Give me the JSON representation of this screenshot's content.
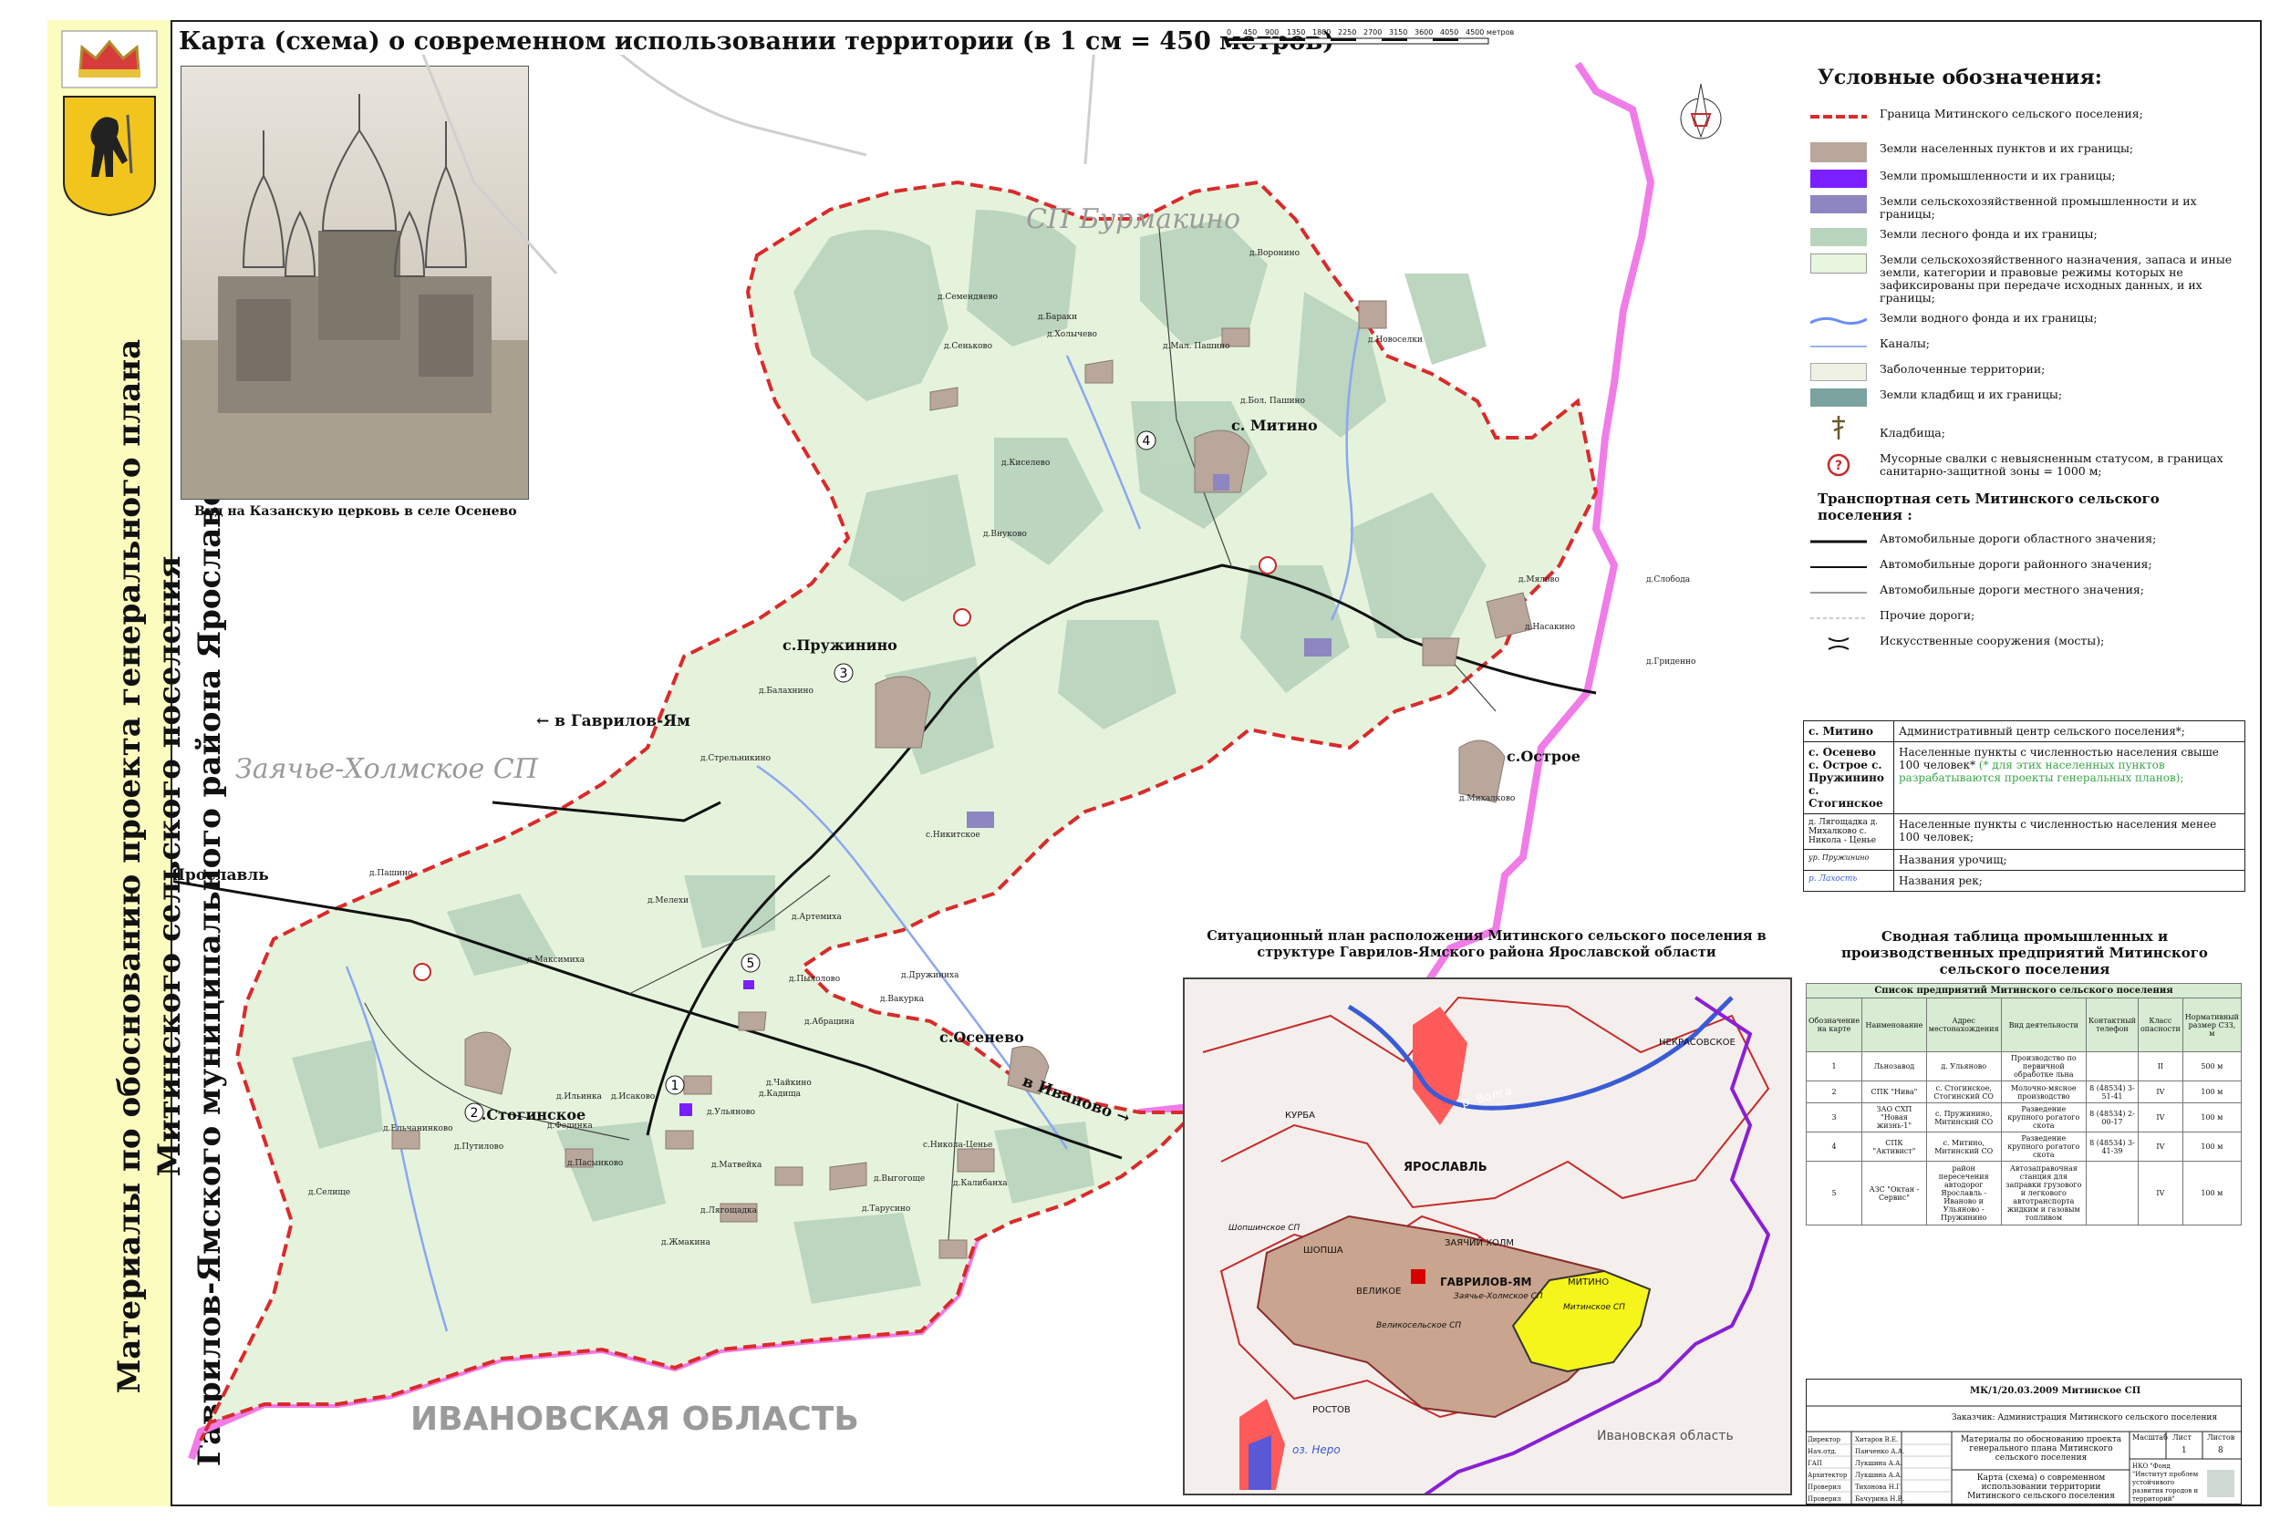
{
  "title_vertical": [
    "Материалы по обоснованию проекта генерального плана",
    "Митинского сельского поселения",
    "Гаврилов-Ямского муниципального района Ярославской области"
  ],
  "header": {
    "title": "Карта (схема) о современном использовании территории (в 1 см = 450 метров)",
    "scale_ticks": [
      "0",
      "450",
      "900",
      "1350",
      "1800",
      "2250",
      "2700",
      "3150",
      "3600",
      "4050",
      "4500 метров"
    ]
  },
  "photo": {
    "caption": "Вид на Казанскую церковь в селе Осенево"
  },
  "map": {
    "neighbors": [
      "СП Бурмакино",
      "Заячье-Холмское СП",
      "ИВАНОВСКАЯ ОБЛАСТЬ"
    ],
    "directions": [
      "← в Гаврилов-Ям",
      "← в Ярославль",
      "в Иваново →"
    ],
    "main_villages": [
      "с. Митино",
      "с.Пружинино",
      "с.Острое",
      "с.Осенево",
      "с.Стогинское"
    ],
    "numbers": [
      "1",
      "2",
      "3",
      "4",
      "5"
    ],
    "villages": [
      "д.Воронино",
      "д.Новоселки",
      "д.Мал. Пашино",
      "д.Бол. Пашино",
      "д.Семендяево",
      "д.Бараки",
      "д.Холычево",
      "д.Сеньково",
      "д.Киселево",
      "д.Внуково",
      "д.Мялово",
      "д.Слобода",
      "д.Насакино",
      "д.Гриденно",
      "д.Михалково",
      "д.Балахнино",
      "д.Стрельникино",
      "с.Никитское",
      "д.Мелехи",
      "д.Артемиха",
      "д.Пашино",
      "д.Максимиха",
      "д.Пылолово",
      "д.Дружиниха",
      "д.Вакурка",
      "д.Абрацина",
      "д.Ильинка",
      "д.Исаково",
      "д.Ульяново",
      "д.Кадища",
      "д.Фединка",
      "д.Ельчанинково",
      "д.Путилово",
      "д.Пасынково",
      "д.Чайкино",
      "д.Матвейка",
      "д.Лягощадка",
      "д.Жмакина",
      "д.Селище",
      "с.Никола-Ценье",
      "д.Выгогоще",
      "д.Калибанха",
      "д.Тарусино"
    ]
  },
  "legend": {
    "title": "Условные обозначения:",
    "items": [
      {
        "label": "Граница Митинского сельского поселения;",
        "color": "#d92b2b"
      },
      {
        "label": "Земли населенных пунктов и их границы;",
        "color": "#b9a79c"
      },
      {
        "label": "Земли промышленности и их границы;",
        "color": "#7a1fff"
      },
      {
        "label": "Земли сельскохозяйственной промышленности и их границы;",
        "color": "#8d86c0"
      },
      {
        "label": "Земли лесного фонда и их границы;",
        "color": "#b9d4bd"
      },
      {
        "label": "Земли сельскохозяйственного назначения, запаса и иные земли, категории и правовые режимы которых не зафиксированы при передаче исходных данных, и их границы;",
        "color": "#e8f5df"
      },
      {
        "label": "Земли водного фонда и их границы;",
        "color": "#6b8df5"
      },
      {
        "label": "Каналы;",
        "color": "#9bb2f2"
      },
      {
        "label": "Заболоченные территории;",
        "color": "#eef1e4"
      },
      {
        "label": "Земли кладбищ и их границы;",
        "color": "#7aa29f"
      },
      {
        "label": "Кладбища;",
        "color": "#6b5a2e"
      },
      {
        "label": "Мусорные свалки с невыясненным статусом, в границах санитарно-защитной зоны = 1000 м;",
        "color": "#c62b2b"
      }
    ],
    "transport_title": "Транспортная сеть Митинского сельского поселения :",
    "transport": [
      "Автомобильные дороги областного значения;",
      "Автомобильные дороги районного значения;",
      "Автомобильные дороги местного значения;",
      "Прочие дороги;",
      "Искусственные сооружения (мосты);"
    ]
  },
  "info_table": [
    {
      "key": "с. Митино",
      "value": "Административный центр сельского поселения*;",
      "note": ""
    },
    {
      "key": "с. Осенево с. Острое с. Пружинино с. Стогинское",
      "value": "Населенные пункты с численностью населения свыше 100 человек*",
      "note": "(* для этих населенных пунктов разрабатываются проекты генеральных планов);"
    },
    {
      "key": "д. Лягощадка д. Михалково с. Никола - Ценье",
      "value": "Населенные пункты с численностью населения менее 100 человек;",
      "note": ""
    },
    {
      "key": "ур. Пружинино",
      "value": "Названия урочищ;",
      "note": ""
    },
    {
      "key": "р. Лахость",
      "value": "Названия рек;",
      "note": ""
    }
  ],
  "situation": {
    "title": "Ситуационный план расположения Митинского сельского поселения в структуре Гаврилов-Ямского района Ярославской области",
    "labels": [
      "ЯРОСЛАВЛЬ",
      "НЕКРАСОВСКОЕ",
      "р. Волга",
      "КУРБА",
      "ШОПША",
      "ВЕЛИКОЕ",
      "ЗАЯЧИЙ ХОЛМ",
      "МИТИНО",
      "ГАВРИЛОВ-ЯМ",
      "Заячье-Холмское СП",
      "Митинское СП",
      "Шопшинское СП",
      "Великосельское СП",
      "РОСТОВ",
      "оз. Неро",
      "Ивановская область"
    ]
  },
  "production": {
    "title": "Сводная таблица промышленных и производственных предприятий Митинского сельского поселения",
    "caption": "Список предприятий Митинского сельского поселения",
    "headers": [
      "Обозначение на карте",
      "Наименование",
      "Адрес местонахождения",
      "Вид деятельности",
      "Контактный телефон",
      "Класс опасности",
      "Нормативный размер СЗЗ, м"
    ],
    "rows": [
      [
        "1",
        "Льнозавод",
        "д. Ульяново",
        "Производство по первичной обработке льна",
        "",
        "II",
        "500 м"
      ],
      [
        "2",
        "СПК \"Нива\"",
        "с. Стогинское, Стогинский СО",
        "Молочно-мясное производство",
        "8 (48534) 3-51-41",
        "IV",
        "100 м"
      ],
      [
        "3",
        "ЗАО СХП \"Новая жизнь-1\"",
        "с. Пружинино, Митинский СО",
        "Разведение крупного рогатого скота",
        "8 (48534) 2-00-17",
        "IV",
        "100 м"
      ],
      [
        "4",
        "СПК \"Активист\"",
        "с. Митино, Митинский СО",
        "Разведение крупного рогатого скота",
        "8 (48534) 3-41-39",
        "IV",
        "100 м"
      ],
      [
        "5",
        "АЗС \"Октан - Сервис\"",
        "район пересечения автодорог Ярославль - Иваново и Ульяново - Пружинино",
        "Автозаправочная станция для заправки грузового и легкового автотранспорта жидким и газовым топливом",
        "",
        "IV",
        "100 м"
      ]
    ]
  },
  "stamp": {
    "code": "МК/1/20.03.2009 Митинское СП",
    "customer": "Заказчик: Администрация Митинского сельского поселения",
    "work": "Материалы по обоснованию проекта генерального плана Митинского сельского поселения",
    "sheet": "Карта (схема) о современном использовании территории Митинского сельского поселения",
    "org": "НКО \"Фонд \"Институт проблем устойчивого развития городов и территорий\"",
    "stage_label": "Масштаб",
    "sheet_label": "Лист",
    "sheets_label": "Листов",
    "sheet_no": "1",
    "sheets_no": "8",
    "roles": [
      {
        "role": "Директор",
        "name": "Хитаров В.Е."
      },
      {
        "role": "Нач.отд.",
        "name": "Панченко А.А."
      },
      {
        "role": "ГАП",
        "name": "Лукшина А.А."
      },
      {
        "role": "Архитектор",
        "name": "Лукшина А.А."
      },
      {
        "role": "Проверил",
        "name": "Тихонова Н.Г."
      },
      {
        "role": "Проверил",
        "name": "Бачурина Н.В."
      }
    ]
  }
}
